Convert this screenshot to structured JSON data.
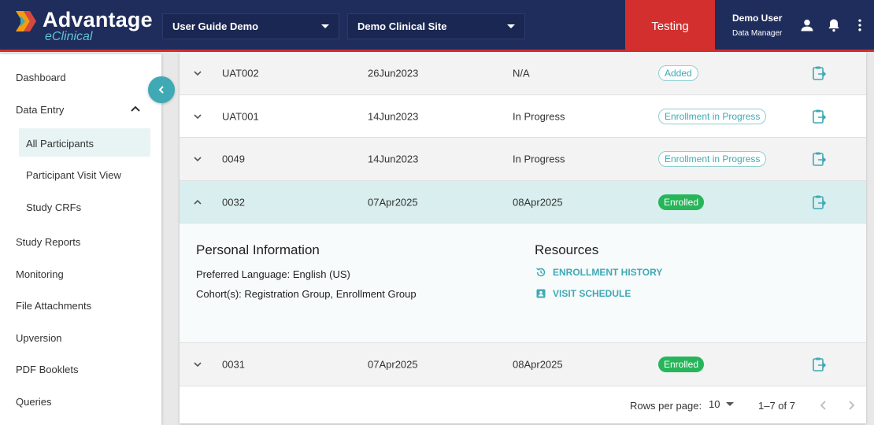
{
  "header": {
    "brand": "Advantage",
    "brand_sub": "eClinical",
    "study_select": "User Guide Demo",
    "site_select": "Demo Clinical Site",
    "env_label": "Testing",
    "user_name": "Demo User",
    "user_role": "Data Manager",
    "accent_color": "#d32f2f"
  },
  "sidebar": {
    "items": [
      {
        "label": "Dashboard"
      },
      {
        "label": "Data Entry"
      },
      {
        "label": "All Participants"
      },
      {
        "label": "Participant Visit View"
      },
      {
        "label": "Study CRFs"
      },
      {
        "label": "Study Reports"
      },
      {
        "label": "Monitoring"
      },
      {
        "label": "File Attachments"
      },
      {
        "label": "Upversion"
      },
      {
        "label": "PDF Booklets"
      },
      {
        "label": "Queries"
      }
    ]
  },
  "rows": [
    {
      "id": "UAT002",
      "date": "26Jun2023",
      "status": "N/A",
      "badge": "Added"
    },
    {
      "id": "UAT001",
      "date": "14Jun2023",
      "status": "In Progress",
      "badge": "Enrollment in Progress"
    },
    {
      "id": "0049",
      "date": "14Jun2023",
      "status": "In Progress",
      "badge": "Enrollment in Progress"
    },
    {
      "id": "0032",
      "date": "07Apr2025",
      "status": "08Apr2025",
      "badge": "Enrolled"
    },
    {
      "id": "0031",
      "date": "07Apr2025",
      "status": "08Apr2025",
      "badge": "Enrolled"
    }
  ],
  "detail": {
    "personal_title": "Personal Information",
    "language": "Preferred Language: English (US)",
    "cohorts": "Cohort(s): Registration Group, Enrollment Group",
    "resources_title": "Resources",
    "link_history": "ENROLLMENT HISTORY",
    "link_schedule": "VISIT SCHEDULE"
  },
  "footer": {
    "rows_per_page_label": "Rows per page:",
    "rows_per_page_value": "10",
    "range": "1–7 of 7"
  }
}
